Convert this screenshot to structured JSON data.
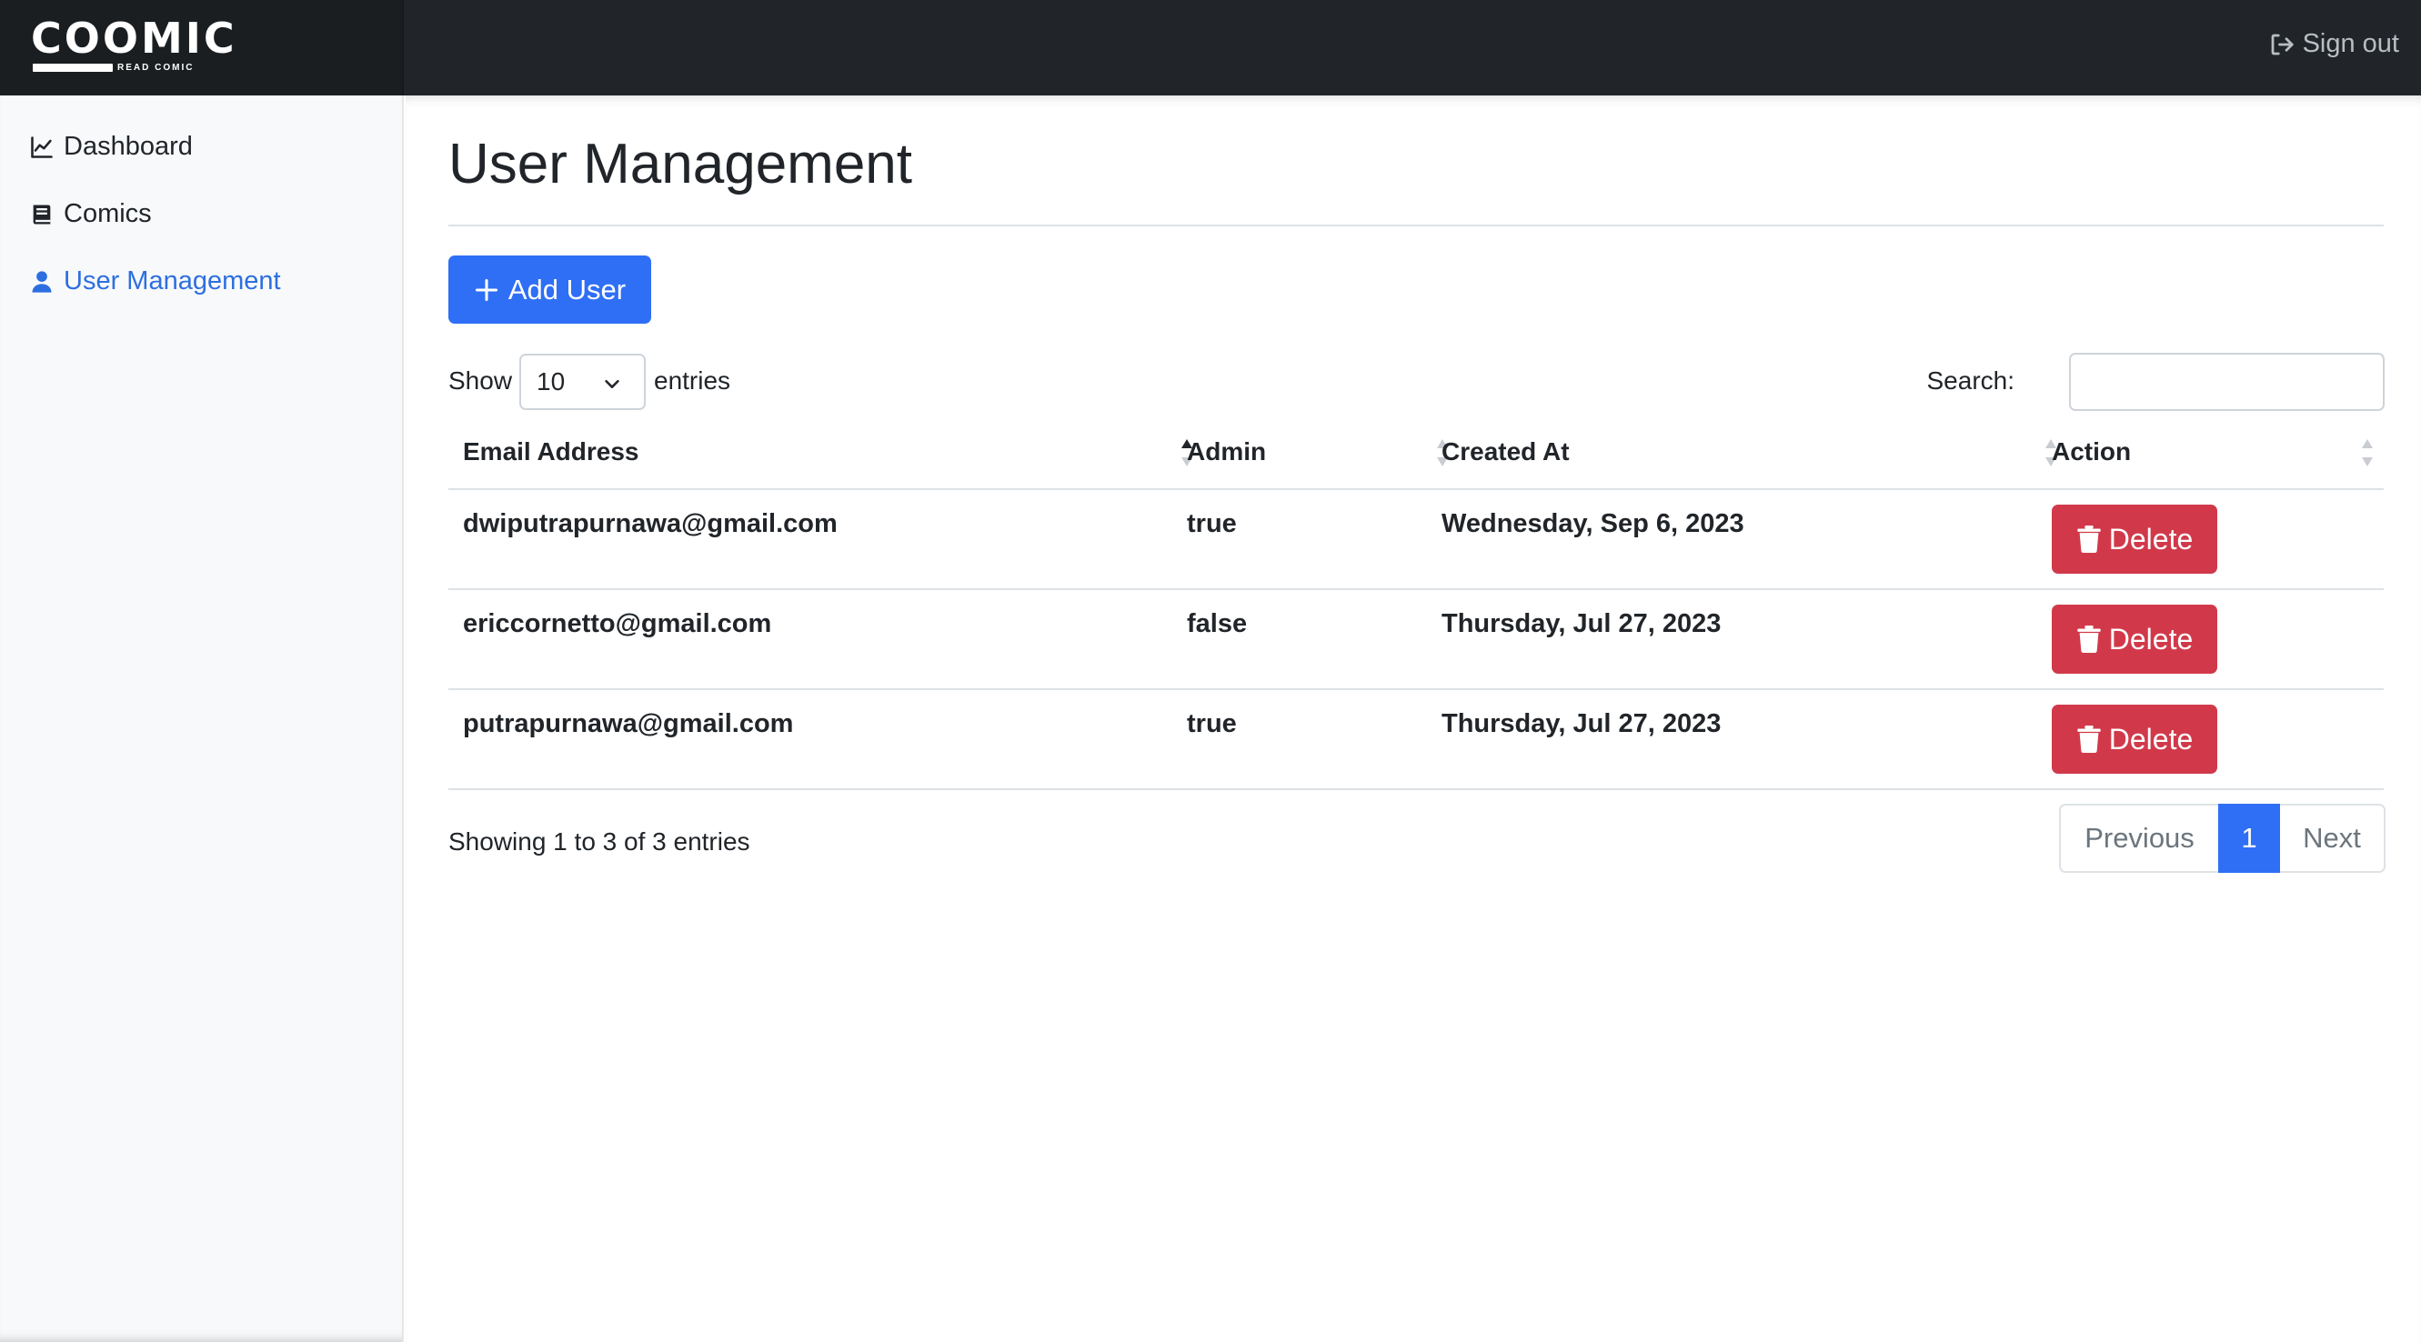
{
  "brand": {
    "name": "COOMIC",
    "tagline": "READ COMIC"
  },
  "header": {
    "signout_label": "Sign out",
    "signout_icon": "sign-out-icon"
  },
  "sidebar": {
    "items": [
      {
        "label": "Dashboard",
        "icon": "line-chart-icon",
        "active": false
      },
      {
        "label": "Comics",
        "icon": "book-icon",
        "active": false
      },
      {
        "label": "User Management",
        "icon": "user-icon",
        "active": true
      }
    ]
  },
  "main": {
    "title": "User Management",
    "add_button": "Add User",
    "length": {
      "show": "Show",
      "value": "10",
      "entries": "entries"
    },
    "search": {
      "label": "Search:",
      "value": ""
    },
    "table": {
      "headers": [
        "Email Address",
        "Admin",
        "Created At",
        "Action"
      ],
      "rows": [
        {
          "email": "dwiputrapurnawa@gmail.com",
          "admin": "true",
          "created": "Wednesday, Sep 6, 2023",
          "action": "Delete"
        },
        {
          "email": "ericcornetto@gmail.com",
          "admin": "false",
          "created": "Thursday, Jul 27, 2023",
          "action": "Delete"
        },
        {
          "email": "putrapurnawa@gmail.com",
          "admin": "true",
          "created": "Thursday, Jul 27, 2023",
          "action": "Delete"
        }
      ]
    },
    "info": "Showing 1 to 3 of 3 entries",
    "pagination": {
      "previous": "Previous",
      "current": "1",
      "next": "Next"
    }
  },
  "colors": {
    "primary": "#2f6ff5",
    "danger": "#d1394a",
    "navbar": "#212529",
    "active_link": "#2d6fe0"
  }
}
